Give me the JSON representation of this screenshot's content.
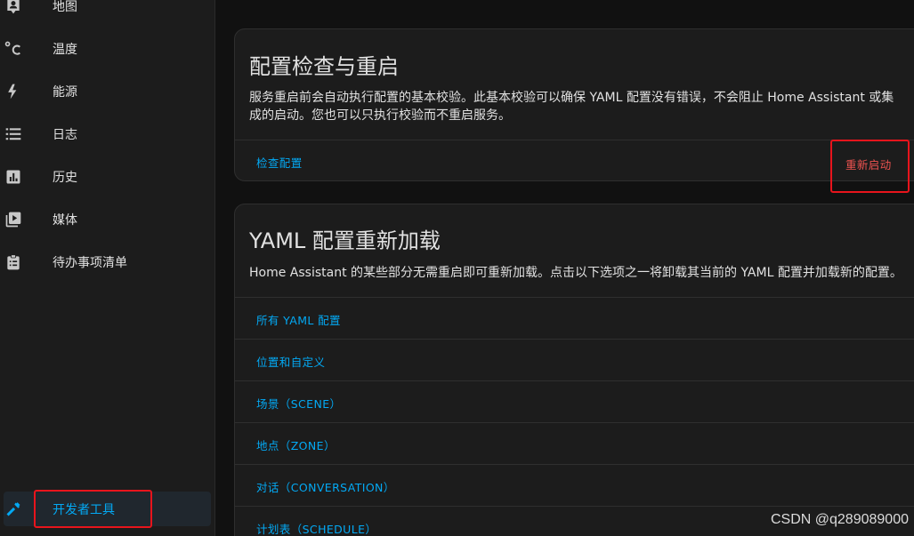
{
  "sidebar": {
    "items": [
      {
        "label": "地图",
        "icon": "map-account-icon"
      },
      {
        "label": "温度",
        "icon": "thermometer-celsius-icon"
      },
      {
        "label": "能源",
        "icon": "lightning-icon"
      },
      {
        "label": "日志",
        "icon": "format-list-icon"
      },
      {
        "label": "历史",
        "icon": "chart-box-icon"
      },
      {
        "label": "媒体",
        "icon": "play-box-multiple-icon"
      },
      {
        "label": "待办事项清单",
        "icon": "clipboard-list-icon"
      }
    ],
    "developer_tools": {
      "label": "开发者工具",
      "icon": "hammer-icon"
    }
  },
  "config_check": {
    "title": "配置检查与重启",
    "description": "服务重启前会自动执行配置的基本校验。此基本校验可以确保 YAML 配置没有错误，不会阻止 Home Assistant 或集成的启动。您也可以只执行校验而不重启服务。",
    "check_button": "检查配置",
    "restart_button": "重新启动"
  },
  "yaml_reload": {
    "title": "YAML 配置重新加载",
    "description": "Home Assistant 的某些部分无需重启即可重新加载。点击以下选项之一将卸载其当前的 YAML 配置并加载新的配置。",
    "items": [
      "所有 YAML 配置",
      "位置和自定义",
      "场景（SCENE）",
      "地点（ZONE）",
      "对话（CONVERSATION）",
      "计划表（SCHEDULE）"
    ]
  },
  "watermark": "CSDN @q289089000",
  "colors": {
    "accent": "#03a9f4",
    "danger": "#ef5350",
    "highlight": "#e8141c"
  }
}
